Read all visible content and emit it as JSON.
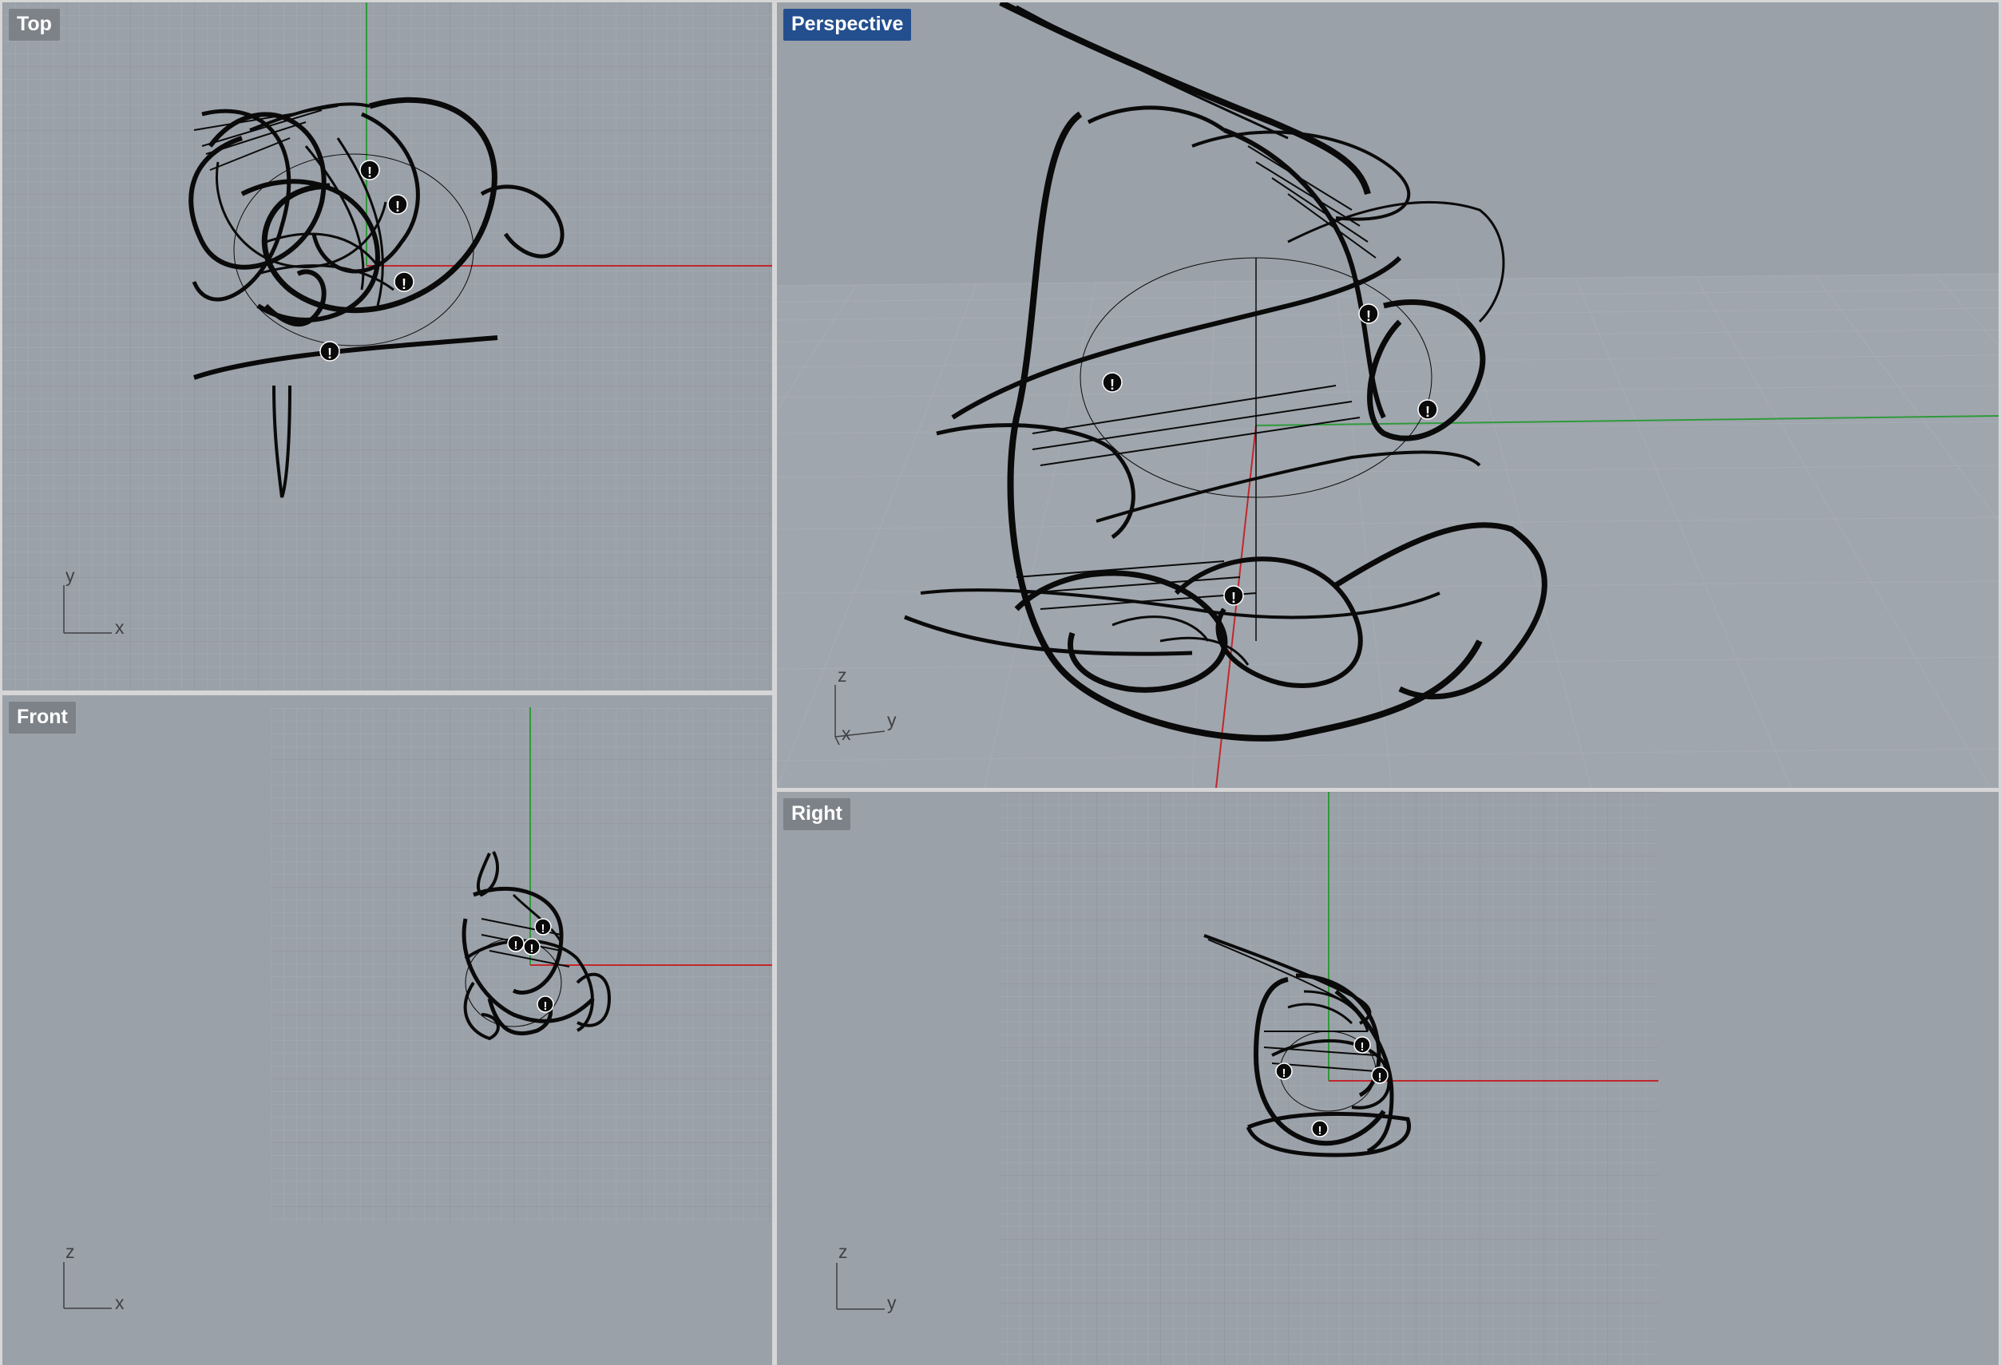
{
  "viewports": {
    "top": {
      "label": "Top",
      "axis_h": "x",
      "axis_v": "y"
    },
    "persp": {
      "label": "Perspective",
      "axis_h": "y",
      "axis_v": "z",
      "axis_d": "x",
      "active": true
    },
    "front": {
      "label": "Front",
      "axis_h": "x",
      "axis_v": "z"
    },
    "right": {
      "label": "Right",
      "axis_h": "y",
      "axis_v": "z"
    }
  },
  "warning_glyph": "!",
  "colors": {
    "viewport_bg": "#9ba1a8",
    "grid_minor": "#a7adb4",
    "grid_major": "#8f959c",
    "x_axis": "#c0272d",
    "y_axis": "#2e9a3a",
    "geometry": "#0a0a0a",
    "active_label": "#244f8e",
    "inactive_label": "#7d8288"
  }
}
